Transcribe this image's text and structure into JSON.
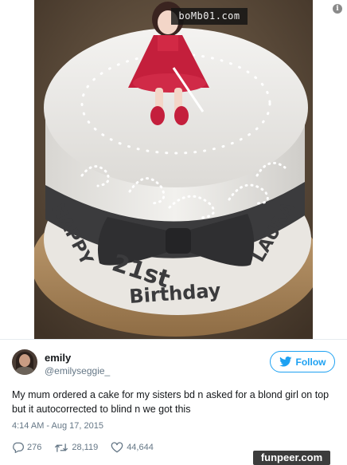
{
  "watermark": {
    "top_text": "boMb01.com",
    "bottom_text": "funpeer.com"
  },
  "cake": {
    "lettering_left": "HAPPY",
    "lettering_21st": "21st",
    "lettering_birthday": "Birthday",
    "lettering_name": "LAURA"
  },
  "tweet": {
    "name": "emily",
    "handle": "@emilyseggie_",
    "follow_label": "Follow",
    "text": "My mum ordered a cake for my sisters bd n asked for a blond girl on top but it autocorrected to blind n we got this",
    "timestamp": "4:14 AM - Aug 17, 2015",
    "replies": "276",
    "retweets": "28,119",
    "likes": "44,644"
  },
  "colors": {
    "twitter_blue": "#1da1f2",
    "secondary_text": "#657786"
  },
  "icons": {
    "info": "info-icon",
    "bird": "twitter-bird-icon",
    "reply": "reply-icon",
    "retweet": "retweet-icon",
    "like": "heart-icon"
  }
}
